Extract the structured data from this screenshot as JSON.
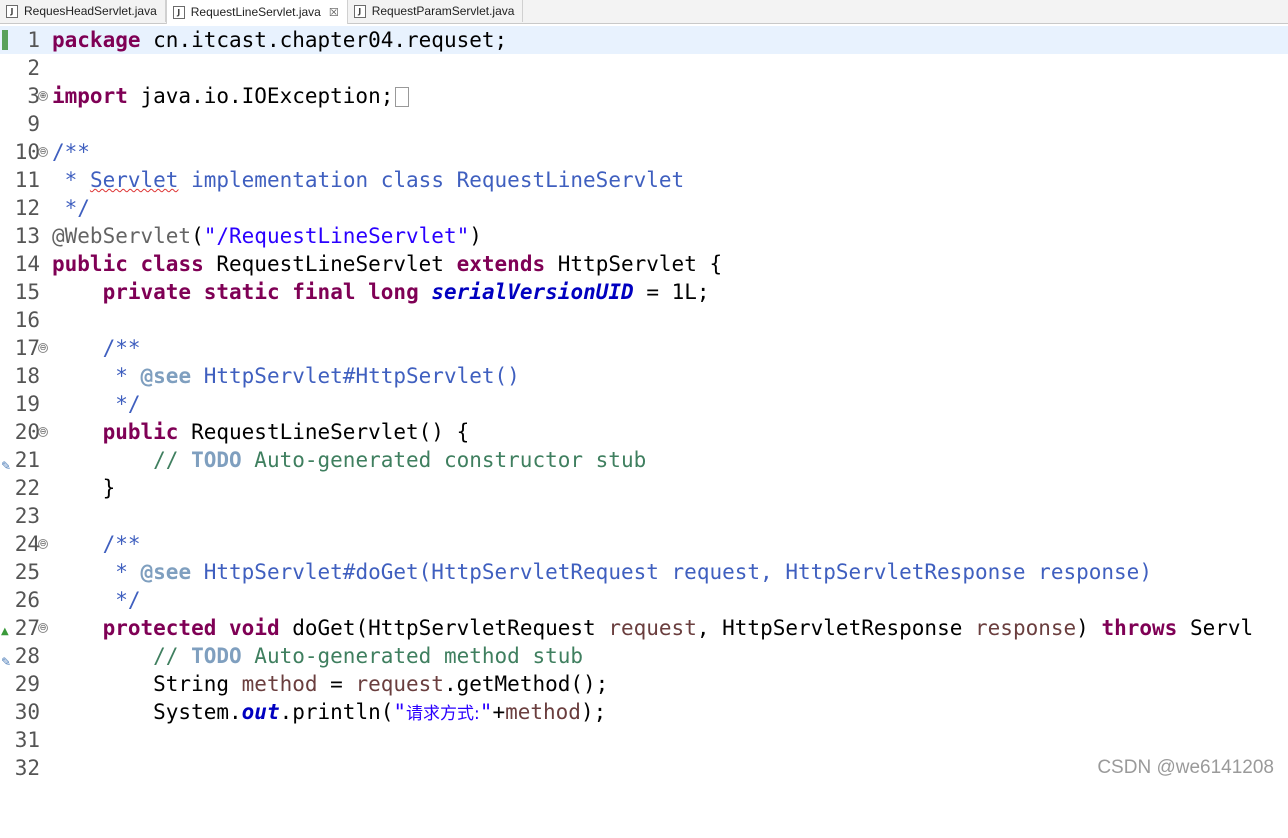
{
  "tabs": [
    {
      "label": "RequesHeadServlet.java",
      "active": false
    },
    {
      "label": "RequestLineServlet.java",
      "active": true,
      "close": "☒"
    },
    {
      "label": "RequestParamServlet.java",
      "active": false
    }
  ],
  "lines": {
    "n1": "1",
    "n2": "2",
    "n3": "3",
    "n9": "9",
    "n10": "10",
    "n11": "11",
    "n12": "12",
    "n13": "13",
    "n14": "14",
    "n15": "15",
    "n16": "16",
    "n17": "17",
    "n18": "18",
    "n19": "19",
    "n20": "20",
    "n21": "21",
    "n22": "22",
    "n23": "23",
    "n24": "24",
    "n25": "25",
    "n26": "26",
    "n27": "27",
    "n28": "28",
    "n29": "29",
    "n30": "30",
    "n31": "31",
    "n32": "32"
  },
  "code": {
    "l1_kw": "package",
    "l1_rest": " cn.itcast.chapter04.requset;",
    "l3_kw": "import",
    "l3_rest": " java.io.IOException;",
    "l10": "/**",
    "l11_a": " * ",
    "l11_b": "Servlet",
    "l11_c": " implementation class RequestLineServlet",
    "l12": " */",
    "l13_a": "@WebServlet",
    "l13_b": "(",
    "l13_c": "\"/RequestLineServlet\"",
    "l13_d": ")",
    "l14_a": "public",
    "l14_b": " ",
    "l14_c": "class",
    "l14_d": " RequestLineServlet ",
    "l14_e": "extends",
    "l14_f": " HttpServlet {",
    "l15_a": "    ",
    "l15_b": "private",
    "l15_c": " ",
    "l15_d": "static",
    "l15_e": " ",
    "l15_f": "final",
    "l15_g": " ",
    "l15_h": "long",
    "l15_i": " ",
    "l15_j": "serialVersionUID",
    "l15_k": " = 1L;",
    "l17": "    /**",
    "l18_a": "     * ",
    "l18_b": "@see",
    "l18_c": " HttpServlet#HttpServlet()",
    "l19": "     */",
    "l20_a": "    ",
    "l20_b": "public",
    "l20_c": " RequestLineServlet() {",
    "l21_a": "        // ",
    "l21_b": "TODO",
    "l21_c": " Auto-generated constructor stub",
    "l22": "    }",
    "l24": "    /**",
    "l25_a": "     * ",
    "l25_b": "@see",
    "l25_c": " HttpServlet#doGet(HttpServletRequest request, HttpServletResponse response)",
    "l26": "     */",
    "l27_a": "    ",
    "l27_b": "protected",
    "l27_c": " ",
    "l27_d": "void",
    "l27_e": " doGet(HttpServletRequest ",
    "l27_f": "request",
    "l27_g": ", HttpServletResponse ",
    "l27_h": "response",
    "l27_i": ") ",
    "l27_j": "throws",
    "l27_k": " Servl",
    "l28_a": "        // ",
    "l28_b": "TODO",
    "l28_c": " Auto-generated method stub",
    "l29_a": "        String ",
    "l29_b": "method",
    "l29_c": " = ",
    "l29_d": "request",
    "l29_e": ".getMethod();",
    "l30_a": "        System.",
    "l30_b": "out",
    "l30_c": ".println(",
    "l30_d": "\"",
    "l30_e": "请求方式:",
    "l30_f": "\"",
    "l30_g": "+",
    "l30_h": "method",
    "l30_i": ");"
  },
  "watermark": "CSDN @we6141208",
  "icons": {
    "java_file": "J",
    "fold_collapse": "⊖",
    "fold_expand": "⊕",
    "override": "▲",
    "task": "✎"
  }
}
